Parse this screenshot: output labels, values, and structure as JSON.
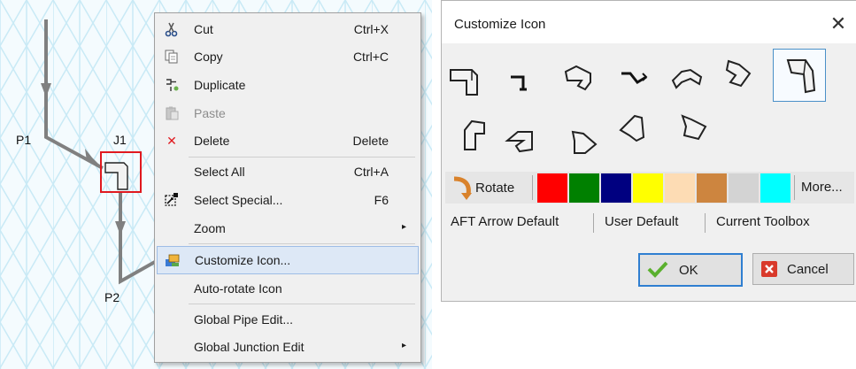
{
  "canvas": {
    "labels": {
      "p1": "P1",
      "j1": "J1",
      "p2": "P2"
    }
  },
  "context_menu": {
    "items": [
      {
        "label": "Cut",
        "shortcut": "Ctrl+X",
        "icon": "scissors-icon"
      },
      {
        "label": "Copy",
        "shortcut": "Ctrl+C",
        "icon": "copy-icon"
      },
      {
        "label": "Duplicate",
        "shortcut": "",
        "icon": "duplicate-icon"
      },
      {
        "label": "Paste",
        "shortcut": "",
        "icon": "paste-icon",
        "disabled": true
      },
      {
        "label": "Delete",
        "shortcut": "Delete",
        "icon": "delete-x-icon"
      },
      {
        "label": "Select All",
        "shortcut": "Ctrl+A",
        "icon": ""
      },
      {
        "label": "Select Special...",
        "shortcut": "F6",
        "icon": "select-special-icon"
      },
      {
        "label": "Zoom",
        "shortcut": "",
        "icon": "",
        "submenu": true
      },
      {
        "label": "Customize Icon...",
        "shortcut": "",
        "icon": "customize-icon",
        "highlighted": true
      },
      {
        "label": "Auto-rotate Icon",
        "shortcut": "",
        "icon": ""
      },
      {
        "label": "Global Pipe Edit...",
        "shortcut": "",
        "icon": ""
      },
      {
        "label": "Global Junction Edit",
        "shortcut": "",
        "icon": "",
        "submenu": true
      }
    ],
    "submenu_arrow": "▸",
    "delete_glyph": "✕"
  },
  "dialog": {
    "title": "Customize Icon",
    "close_glyph": "✕",
    "rotate_label": "Rotate",
    "colors": [
      "#ff0000",
      "#008000",
      "#000080",
      "#ffff00",
      "#fddcb4",
      "#cd853f",
      "#d3d3d3",
      "#00ffff"
    ],
    "more_label": "More...",
    "links": [
      "AFT Arrow Default",
      "User Default",
      "Current Toolbox"
    ],
    "ok_label": "OK",
    "cancel_label": "Cancel"
  }
}
